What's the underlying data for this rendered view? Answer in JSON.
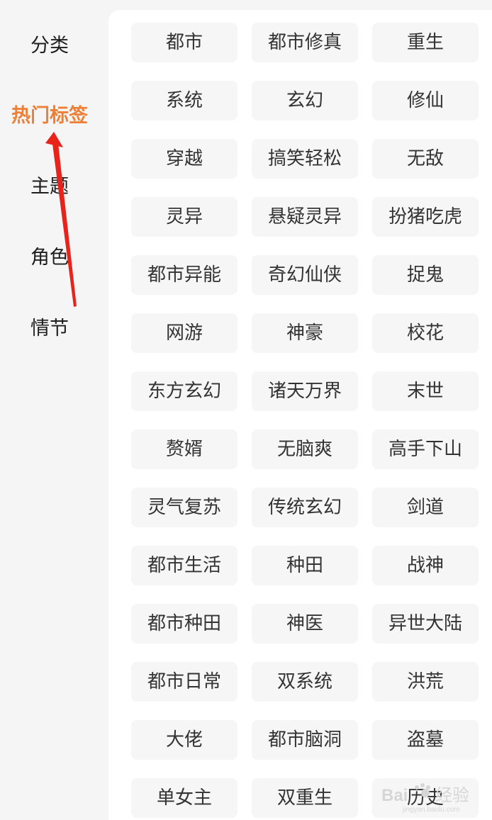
{
  "sidebar": {
    "items": [
      {
        "label": "分类"
      },
      {
        "label": "热门标签",
        "active": true
      },
      {
        "label": "主题"
      },
      {
        "label": "角色"
      },
      {
        "label": "情节"
      }
    ]
  },
  "tags": [
    "都市",
    "都市修真",
    "重生",
    "系统",
    "玄幻",
    "修仙",
    "穿越",
    "搞笑轻松",
    "无敌",
    "灵异",
    "悬疑灵异",
    "扮猪吃虎",
    "都市异能",
    "奇幻仙侠",
    "捉鬼",
    "网游",
    "神豪",
    "校花",
    "东方玄幻",
    "诸天万界",
    "末世",
    "赘婿",
    "无脑爽",
    "高手下山",
    "灵气复苏",
    "传统玄幻",
    "剑道",
    "都市生活",
    "种田",
    "战神",
    "都市种田",
    "神医",
    "异世大陆",
    "都市日常",
    "双系统",
    "洪荒",
    "大佬",
    "都市脑洞",
    "盗墓",
    "单女主",
    "双重生",
    "历史"
  ],
  "watermark": {
    "brand": "Bai",
    "suffix": "经验",
    "domain": "jingyan.baidu.com"
  },
  "colors": {
    "accent": "#ee7f35",
    "arrow": "#e8231b",
    "tag_bg": "#f6f6f6",
    "sidebar_bg": "#f5f5f5"
  },
  "icons": {
    "annotation": "red-arrow-icon",
    "watermark": "baidu-paw-icon"
  }
}
